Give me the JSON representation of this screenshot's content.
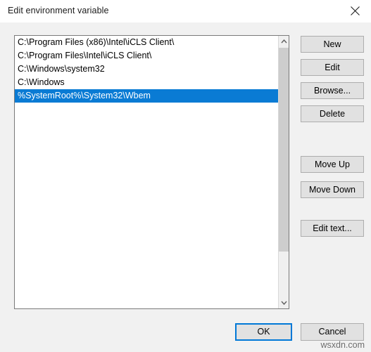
{
  "window": {
    "title": "Edit environment variable",
    "close_icon": "close-icon"
  },
  "list": {
    "items": [
      {
        "path": "C:\\Program Files (x86)\\Intel\\iCLS Client\\",
        "selected": false
      },
      {
        "path": "C:\\Program Files\\Intel\\iCLS Client\\",
        "selected": false
      },
      {
        "path": "C:\\Windows\\system32",
        "selected": false
      },
      {
        "path": "C:\\Windows",
        "selected": false
      },
      {
        "path": "%SystemRoot%\\System32\\Wbem",
        "selected": true
      }
    ],
    "selection_color": "#0a7bd4",
    "scrollbar": {
      "up_arrow_icon": "chevron-up-icon",
      "down_arrow_icon": "chevron-down-icon"
    }
  },
  "side_buttons": {
    "new": "New",
    "edit": "Edit",
    "browse": "Browse...",
    "delete": "Delete",
    "move_up": "Move Up",
    "move_down": "Move Down",
    "edit_text": "Edit text..."
  },
  "footer": {
    "ok": "OK",
    "cancel": "Cancel",
    "focus_color": "#0078d7"
  },
  "watermark": {
    "text": "wsxdn.com"
  }
}
